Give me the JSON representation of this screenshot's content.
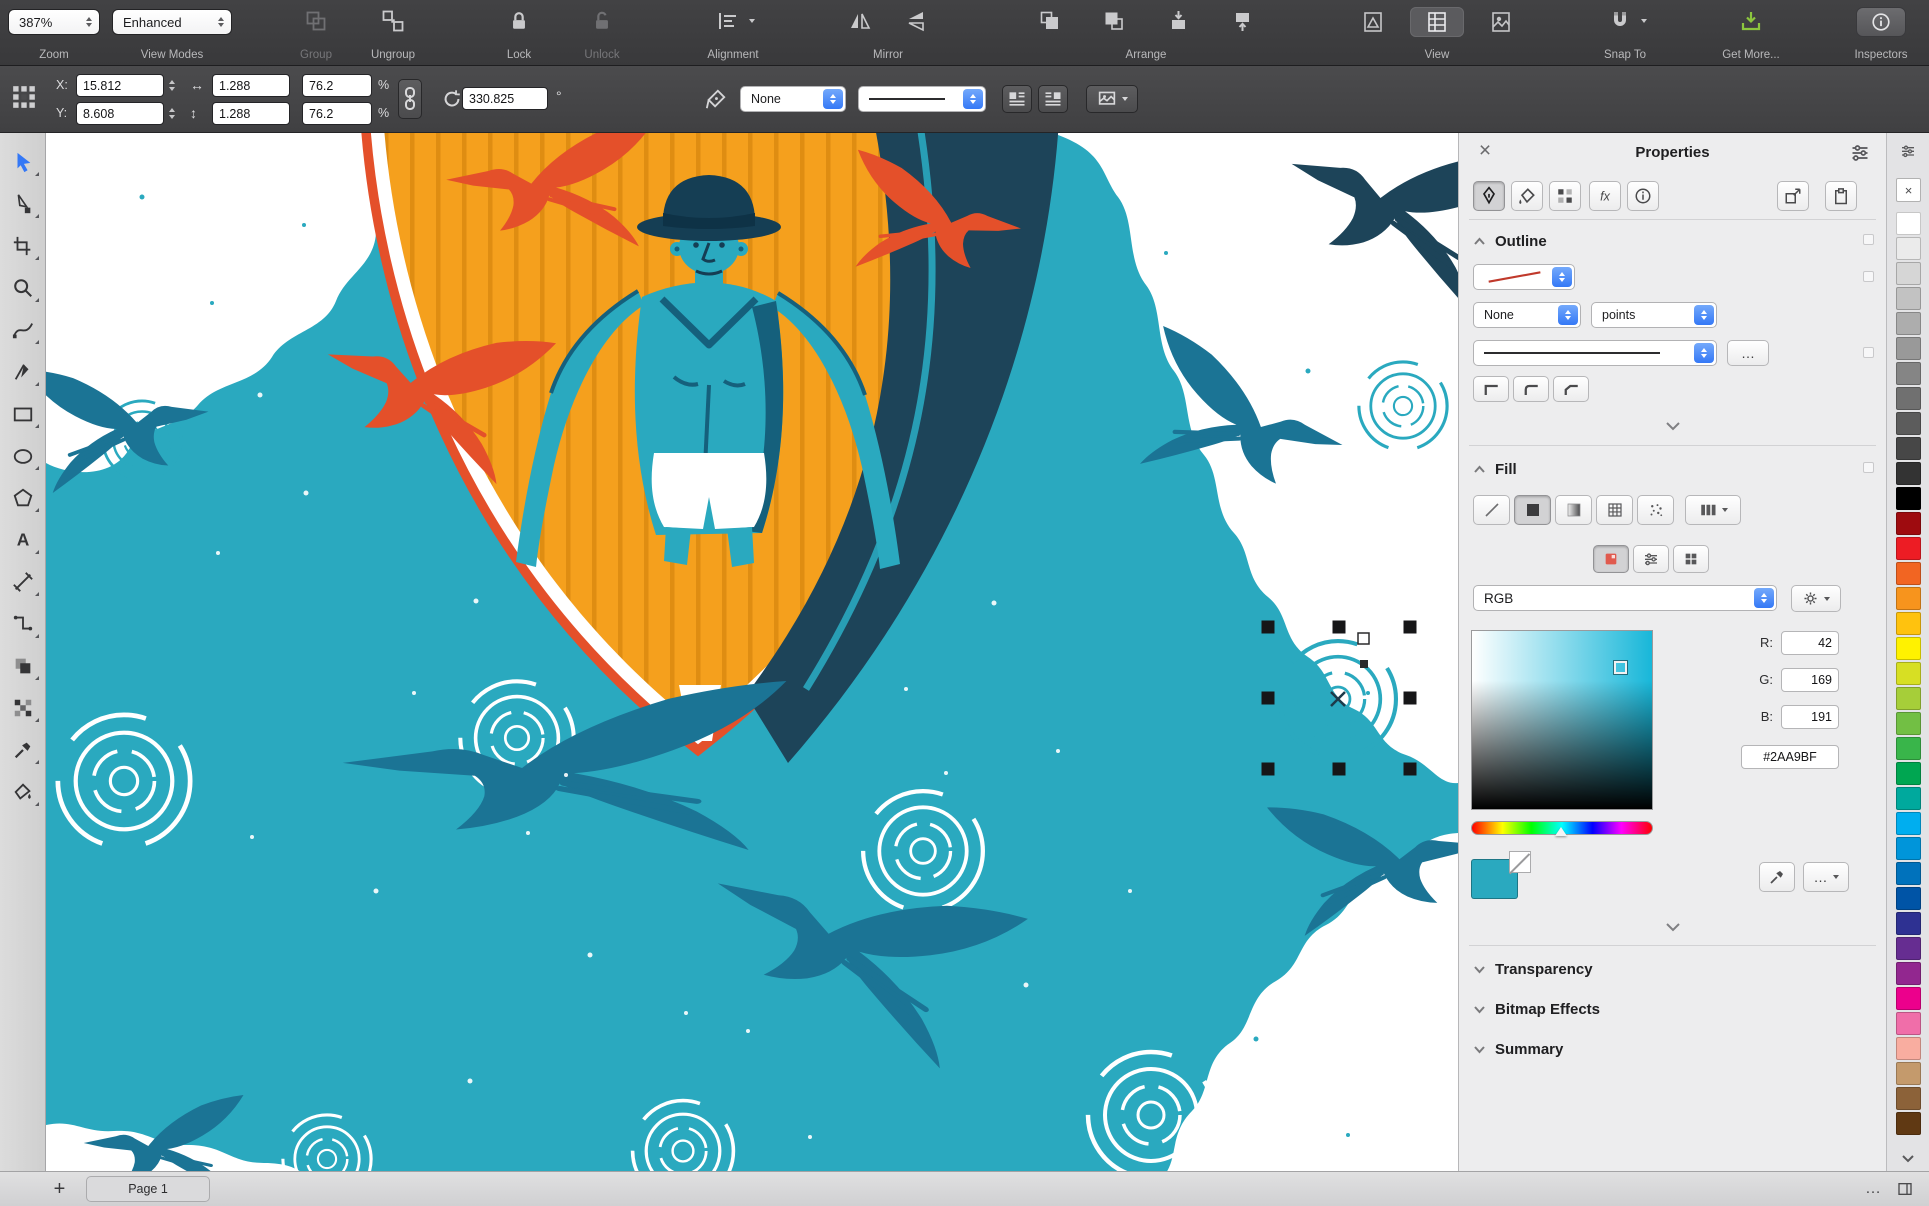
{
  "app": {
    "accent": "#3478F6"
  },
  "toolbar": {
    "zoom_value": "387%",
    "zoom_label": "Zoom",
    "view_modes_value": "Enhanced",
    "view_modes_label": "View Modes",
    "group_label": "Group",
    "ungroup_label": "Ungroup",
    "lock_label": "Lock",
    "unlock_label": "Unlock",
    "alignment_label": "Alignment",
    "mirror_label": "Mirror",
    "arrange_label": "Arrange",
    "view_label": "View",
    "snap_to_label": "Snap To",
    "get_more_label": "Get More...",
    "inspectors_label": "Inspectors"
  },
  "property_bar": {
    "x_label": "X:",
    "x_value": "15.812",
    "y_label": "Y:",
    "y_value": "8.608",
    "width_value": "1.288",
    "height_value": "1.288",
    "scale_w_value": "76.2",
    "scale_h_value": "76.2",
    "percent": "%",
    "rotation_value": "330.825",
    "degrees": "°",
    "outline_width_value": "None"
  },
  "left_toolbar": {
    "tools": [
      "pick",
      "shape",
      "crop",
      "zoom",
      "freehand",
      "pen",
      "rectangle",
      "ellipse",
      "polygon",
      "text",
      "dimension",
      "connector",
      "drop-shadow",
      "transparency",
      "eyedropper",
      "interactive-fill"
    ]
  },
  "panel": {
    "title": "Properties",
    "outline": {
      "title": "Outline",
      "width_value": "None",
      "width_units": "points"
    },
    "fill": {
      "title": "Fill",
      "color_model_value": "RGB",
      "r_label": "R:",
      "r_value": "42",
      "g_label": "G:",
      "g_value": "169",
      "b_label": "B:",
      "b_value": "191",
      "hex_value": "#2AA9BF"
    },
    "transparency_title": "Transparency",
    "bitmap_effects_title": "Bitmap Effects",
    "summary_title": "Summary"
  },
  "palette": {
    "colors": [
      "#FFFFFF",
      "#EBEBEB",
      "#D6D6D6",
      "#C2C2C2",
      "#ADADAD",
      "#999999",
      "#858585",
      "#707070",
      "#5C5C5C",
      "#474747",
      "#333333",
      "#000000",
      "#9E0B0F",
      "#ED1C24",
      "#F26522",
      "#F7941D",
      "#FFC20E",
      "#FFF200",
      "#D7DF23",
      "#A6CE39",
      "#72BF44",
      "#39B54A",
      "#00A651",
      "#00A99D",
      "#00AEEF",
      "#0095DA",
      "#0072BC",
      "#0054A6",
      "#2E3192",
      "#662D91",
      "#92278F",
      "#EC008C",
      "#F06EA9",
      "#F9ADA0",
      "#C49A6C",
      "#8C6239",
      "#603913"
    ]
  },
  "status_bar": {
    "add_page_label": "+",
    "page_label": "Page 1"
  },
  "illustration": {
    "water": "#2AA9BF",
    "bird": "#1B7495",
    "shade": "#15607C",
    "dark": "#1D4459",
    "orange": "#F5A01D",
    "stripe": "#DF8D12",
    "red": "#E4502A",
    "white": "#FFFFFF",
    "hat": "#153E54"
  }
}
